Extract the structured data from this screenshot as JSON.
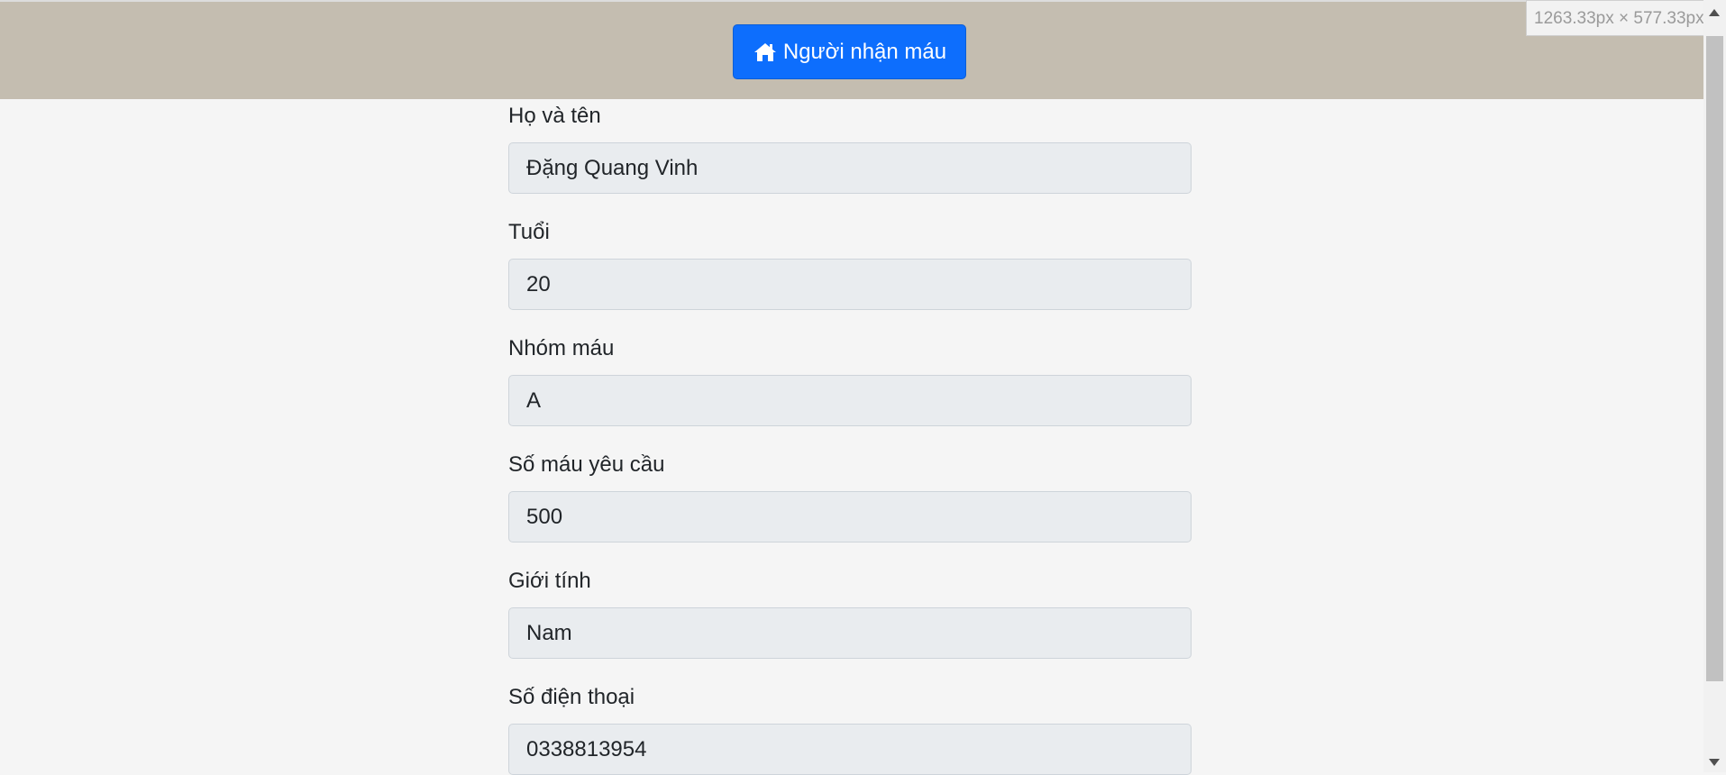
{
  "header": {
    "button_icon": "home-icon",
    "button_label": "Người nhận máu",
    "accent_color": "#0d6efd",
    "background_color": "#c4bdb0"
  },
  "form": {
    "fields": [
      {
        "label": "Họ và tên",
        "value": "Đặng Quang Vinh"
      },
      {
        "label": "Tuổi",
        "value": "20"
      },
      {
        "label": "Nhóm máu",
        "value": "A"
      },
      {
        "label": "Số máu yêu cầu",
        "value": "500"
      },
      {
        "label": "Giới tính",
        "value": "Nam"
      },
      {
        "label": "Số điện thoại",
        "value": "0338813954"
      }
    ]
  },
  "overlay": {
    "viewport_size": "1263.33px × 577.33px"
  }
}
